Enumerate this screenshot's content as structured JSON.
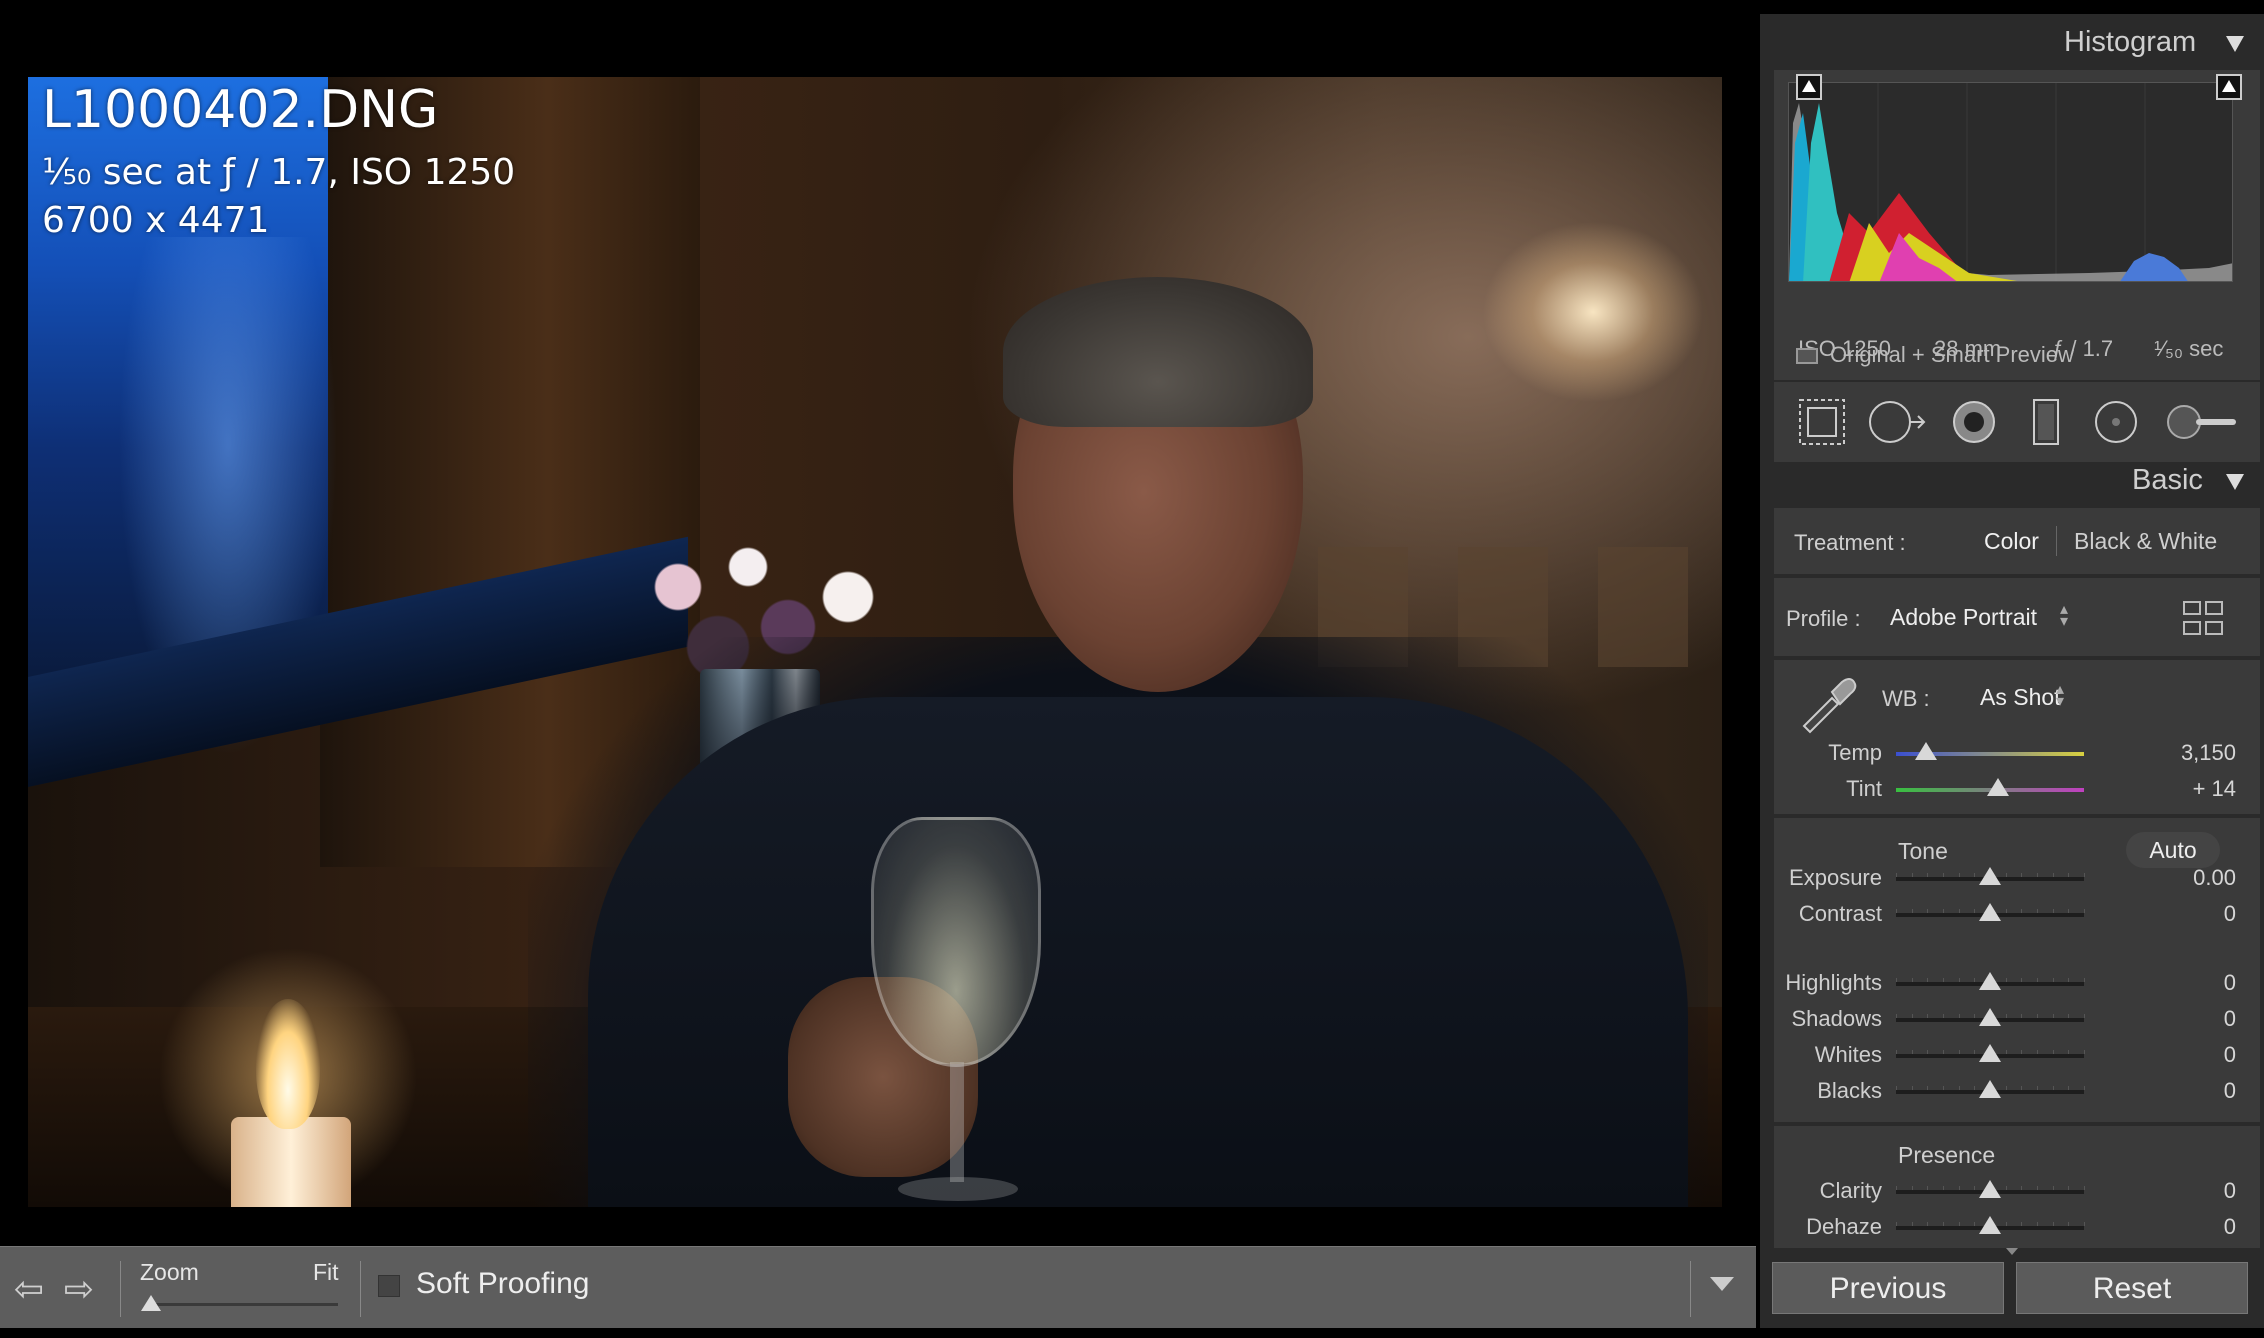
{
  "photo": {
    "file_name": "L1000402.DNG",
    "exposure": "¹⁄₅₀ sec at ƒ / 1.7, ISO 1250",
    "dimensions": "6700 x 4471"
  },
  "toolbar": {
    "prev_arrow": "⇦",
    "next_arrow": "⇨",
    "zoom_label": "Zoom",
    "zoom_value": "Fit",
    "soft_proofing_label": "Soft Proofing",
    "soft_proofing_checked": false
  },
  "histogram": {
    "title": "Histogram",
    "iso": "ISO 1250",
    "focal_length": "28 mm",
    "aperture": "ƒ / 1.7",
    "shutter": "¹⁄₅₀ sec",
    "preview_status": "Original + Smart Preview"
  },
  "tools": [
    "crop-overlay-icon",
    "spot-removal-icon",
    "red-eye-icon",
    "graduated-filter-icon",
    "radial-filter-icon",
    "adjustment-brush-icon"
  ],
  "basic": {
    "title": "Basic",
    "treatment_label": "Treatment :",
    "treatment_color": "Color",
    "treatment_bw": "Black & White",
    "profile_label": "Profile :",
    "profile_value": "Adobe Portrait",
    "wb_label": "WB :",
    "wb_value": "As Shot",
    "temp": {
      "label": "Temp",
      "value": "3,150",
      "position": 0.16
    },
    "tint": {
      "label": "Tint",
      "value": "+ 14",
      "position": 0.54
    },
    "tone_label": "Tone",
    "auto_label": "Auto",
    "tone_sliders": [
      {
        "label": "Exposure",
        "value": "0.00",
        "position": 0.5
      },
      {
        "label": "Contrast",
        "value": "0",
        "position": 0.5
      }
    ],
    "tone_sliders2": [
      {
        "label": "Highlights",
        "value": "0",
        "position": 0.5
      },
      {
        "label": "Shadows",
        "value": "0",
        "position": 0.5
      },
      {
        "label": "Whites",
        "value": "0",
        "position": 0.5
      },
      {
        "label": "Blacks",
        "value": "0",
        "position": 0.5
      }
    ],
    "presence_label": "Presence",
    "presence_sliders": [
      {
        "label": "Clarity",
        "value": "0",
        "position": 0.5
      },
      {
        "label": "Dehaze",
        "value": "0",
        "position": 0.5
      }
    ]
  },
  "buttons": {
    "previous": "Previous",
    "reset": "Reset"
  },
  "colors": {
    "panel_bg": "#3a3a3a",
    "toolbar_bg": "#5d5d5d",
    "temp_gradient": [
      "#3a4fd0",
      "#d8d040"
    ],
    "tint_gradient": [
      "#38c040",
      "#c040c0"
    ]
  }
}
